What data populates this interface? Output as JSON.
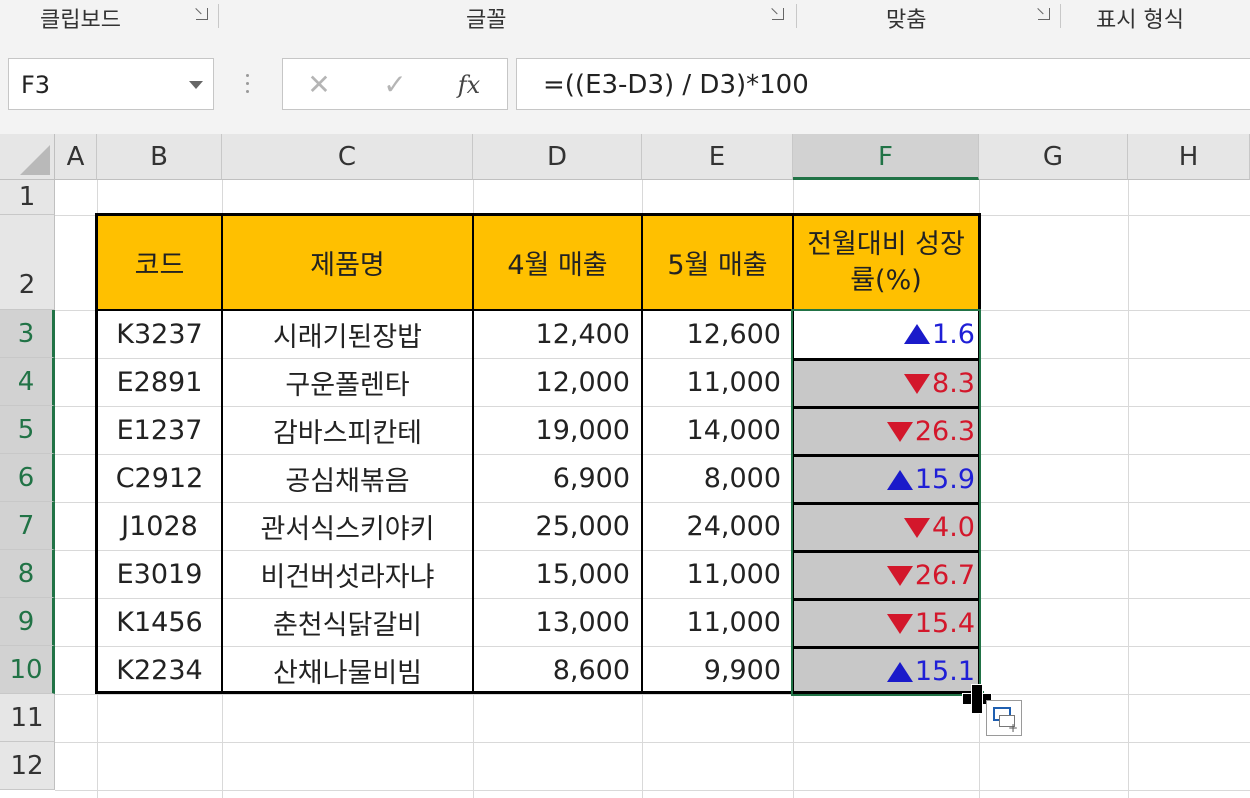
{
  "ribbon": {
    "groups": [
      "클립보드",
      "글꼴",
      "맞춤",
      "표시 형식"
    ]
  },
  "formula_bar": {
    "name_box": "F3",
    "cancel_icon": "✕",
    "enter_icon": "✓",
    "fx_label": "fx",
    "formula": "=((E3-D3) / D3)*100"
  },
  "columns": [
    "A",
    "B",
    "C",
    "D",
    "E",
    "F",
    "G",
    "H"
  ],
  "rows": [
    "1",
    "2",
    "3",
    "4",
    "5",
    "6",
    "7",
    "8",
    "9",
    "10",
    "11",
    "12"
  ],
  "table": {
    "headers": {
      "code": "코드",
      "product": "제품명",
      "april": "4월 매출",
      "may": "5월 매출",
      "growth": "전월대비 성장률(%)"
    },
    "rows": [
      {
        "code": "K3237",
        "product": "시래기된장밥",
        "april": "12,400",
        "may": "12,600",
        "dir": "up",
        "growth": "1.6"
      },
      {
        "code": "E2891",
        "product": "구운폴렌타",
        "april": "12,000",
        "may": "11,000",
        "dir": "down",
        "growth": "8.3"
      },
      {
        "code": "E1237",
        "product": "감바스피칸테",
        "april": "19,000",
        "may": "14,000",
        "dir": "down",
        "growth": "26.3"
      },
      {
        "code": "C2912",
        "product": "공심채볶음",
        "april": "6,900",
        "may": "8,000",
        "dir": "up",
        "growth": "15.9"
      },
      {
        "code": "J1028",
        "product": "관서식스키야키",
        "april": "25,000",
        "may": "24,000",
        "dir": "down",
        "growth": "4.0"
      },
      {
        "code": "E3019",
        "product": "비건버섯라자냐",
        "april": "15,000",
        "may": "11,000",
        "dir": "down",
        "growth": "26.7"
      },
      {
        "code": "K1456",
        "product": "춘천식닭갈비",
        "april": "13,000",
        "may": "11,000",
        "dir": "down",
        "growth": "15.4"
      },
      {
        "code": "K2234",
        "product": "산채나물비빔",
        "april": "8,600",
        "may": "9,900",
        "dir": "up",
        "growth": "15.1"
      }
    ]
  },
  "colors": {
    "header_fill": "#ffc000",
    "selection": "#217346",
    "up": "#1f1fd6",
    "down": "#d3172b",
    "growth_fill": "#c8c8c8"
  }
}
